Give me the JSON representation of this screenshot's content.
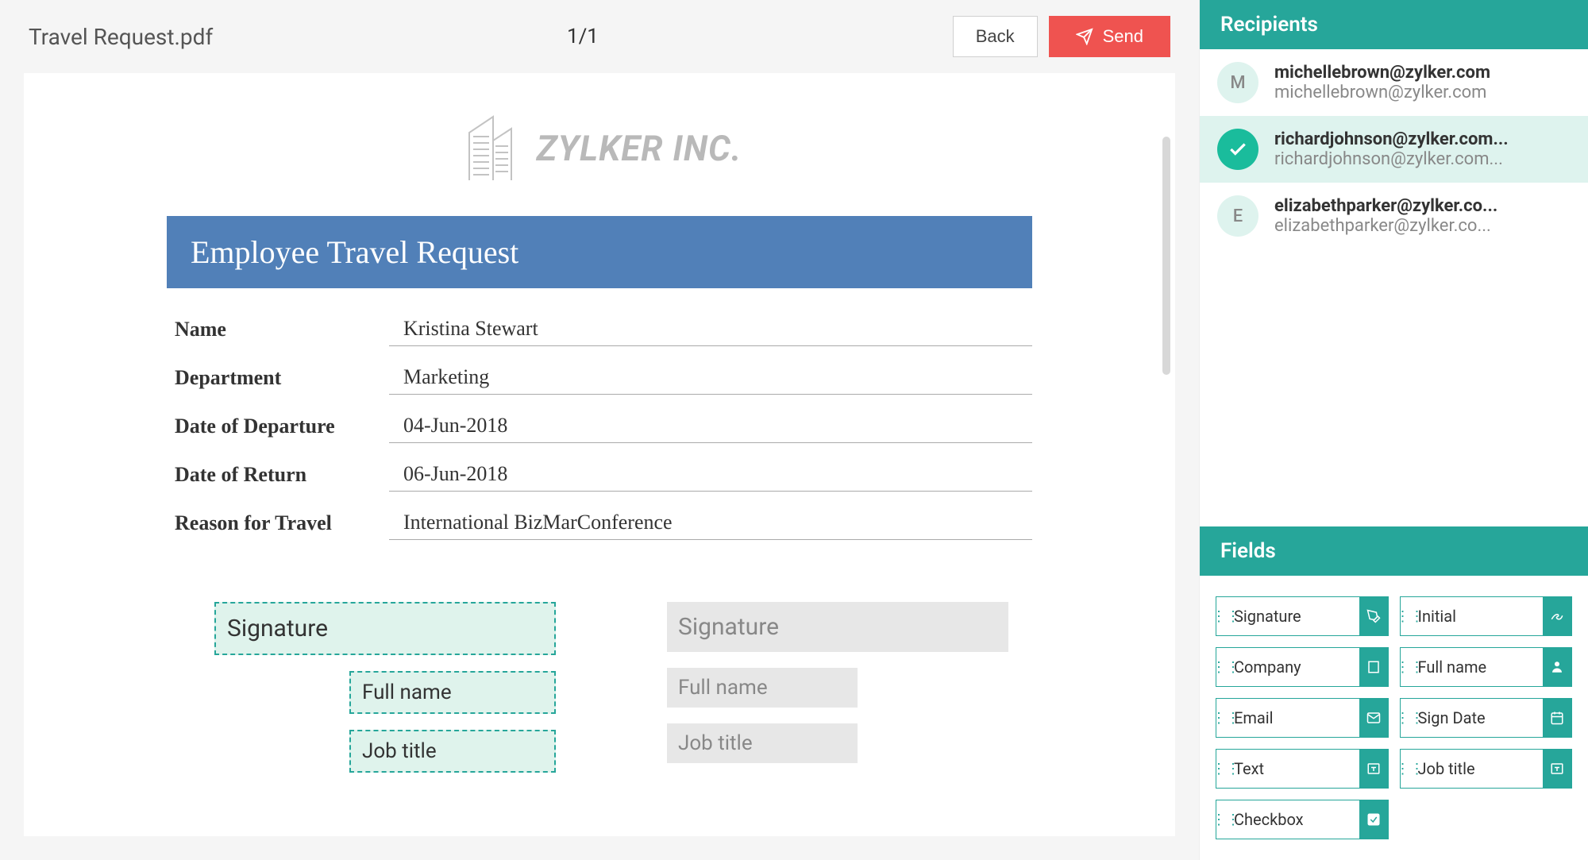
{
  "header": {
    "doc_title": "Travel Request.pdf",
    "page_counter": "1/1",
    "back_label": "Back",
    "send_label": "Send"
  },
  "document": {
    "company_name": "ZYLKER INC.",
    "section_title": "Employee Travel Request",
    "fields": {
      "name": {
        "label": "Name",
        "value": "Kristina Stewart"
      },
      "department": {
        "label": "Department",
        "value": "Marketing"
      },
      "departure": {
        "label": "Date of Departure",
        "value": "04-Jun-2018"
      },
      "return": {
        "label": "Date of Return",
        "value": "06-Jun-2018"
      },
      "reason": {
        "label": "Reason for Travel",
        "value": "International BizMarConference"
      }
    },
    "signer_a": {
      "signature": "Signature",
      "fullname": "Full name",
      "jobtitle": "Job title"
    },
    "signer_b": {
      "signature": "Signature",
      "fullname": "Full name",
      "jobtitle": "Job title"
    }
  },
  "recipients_header": "Recipients",
  "recipients": [
    {
      "initial": "M",
      "name": "michellebrown@zylker.com",
      "email": "michellebrown@zylker.com",
      "selected": false,
      "checked": false
    },
    {
      "initial": "",
      "name": "richardjohnson@zylker.com...",
      "email": "richardjohnson@zylker.com...",
      "selected": true,
      "checked": true
    },
    {
      "initial": "E",
      "name": "elizabethparker@zylker.co...",
      "email": "elizabethparker@zylker.co...",
      "selected": false,
      "checked": false
    }
  ],
  "fields_header": "Fields",
  "field_chips": {
    "signature": "Signature",
    "initial": "Initial",
    "company": "Company",
    "fullname": "Full name",
    "email": "Email",
    "signdate": "Sign Date",
    "text": "Text",
    "jobtitle": "Job title",
    "checkbox": "Checkbox"
  }
}
